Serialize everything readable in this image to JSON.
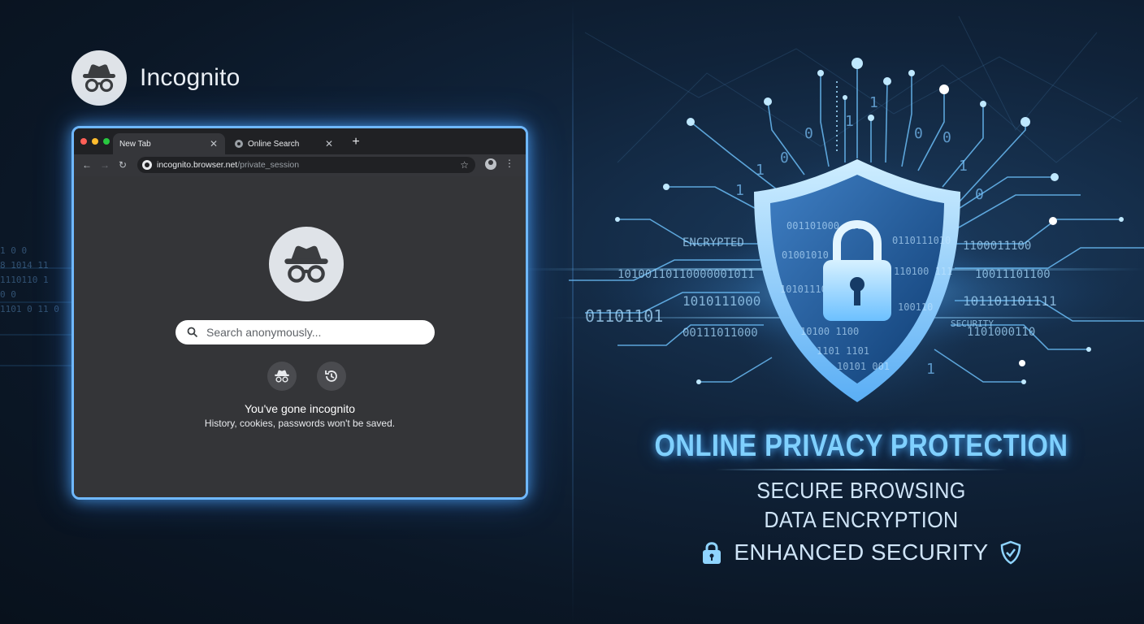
{
  "brand": {
    "name": "Incognito",
    "logo_icon": "incognito-icon"
  },
  "browser": {
    "tabs": [
      {
        "label": "New Tab",
        "active": true
      },
      {
        "label": "Online Search",
        "active": false,
        "favicon": "google-icon"
      }
    ],
    "url_host": "incognito.browser.net",
    "url_path": "/private_session",
    "search_placeholder": "Search anonymously...",
    "page_title": "You've gone incognito",
    "page_subtitle": "History, cookies, passwords won't be saved."
  },
  "promo": {
    "headline": "ONLINE PRIVACY PROTECTION",
    "features": [
      "SECURE BROWSING",
      "DATA ENCRYPTION",
      "ENHANCED SECURITY"
    ]
  },
  "colors": {
    "accent": "#6fb8ff",
    "headline": "#7fd0ff",
    "browser_bg": "#343538",
    "tabstrip": "#202124",
    "page_bg": "#0b1726"
  },
  "decor": {
    "left_bits": [
      "1 0 0",
      "8  1014   11",
      "1110110 1",
      "0 0",
      "1101 0 11 0"
    ],
    "circuit_bits": [
      "1",
      "0",
      "1",
      "0",
      "1",
      "1",
      "0",
      "1",
      "0",
      "1",
      "0"
    ],
    "band_left": [
      "ENCRYPTED",
      "10100110110000001011",
      "1010111000",
      "01101101",
      "00111011000"
    ],
    "shield_bits": [
      "001101000 101",
      "0110111010",
      "01001010",
      "110100 111",
      "1010111000",
      "100110",
      "10100 1100",
      "1101 1101",
      "10101 001"
    ],
    "band_right": [
      "1100011100",
      "10011101100",
      "101101101111",
      "1101000110",
      "SECURITY"
    ]
  }
}
